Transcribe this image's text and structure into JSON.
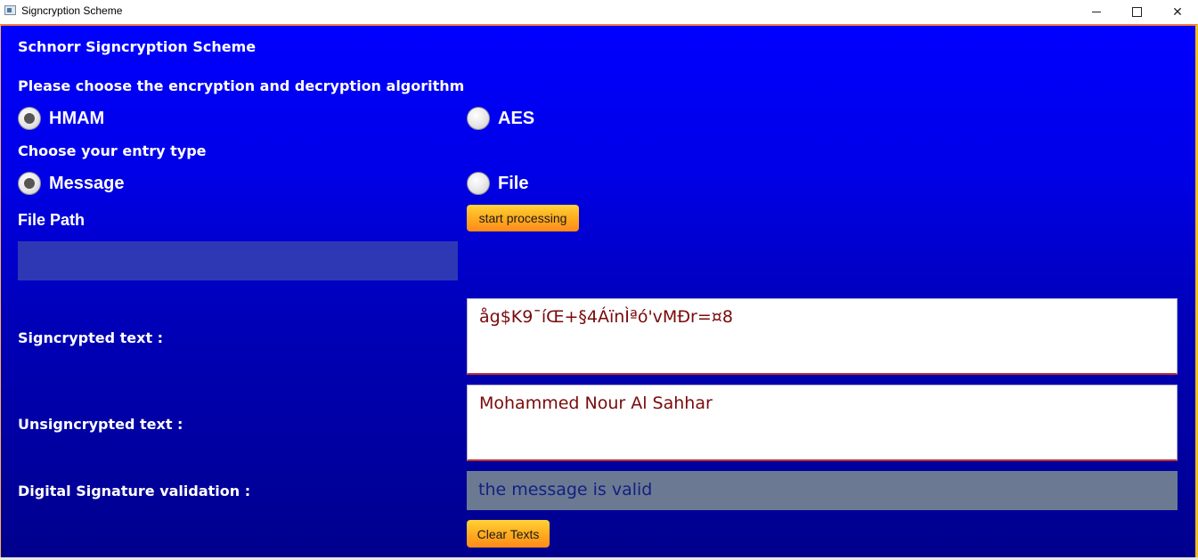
{
  "window": {
    "title": "Signcryption Scheme"
  },
  "app": {
    "heading": "Schnorr Signcryption Scheme",
    "algorithm_prompt": "Please choose the encryption and decryption algorithm",
    "algorithm_options": [
      {
        "label": "HMAM",
        "selected": true
      },
      {
        "label": "AES",
        "selected": false
      }
    ],
    "entry_prompt": "Choose your entry type",
    "entry_options": [
      {
        "label": "Message",
        "selected": true
      },
      {
        "label": "File",
        "selected": false
      }
    ],
    "file_path_label": "File Path",
    "file_path_value": "",
    "start_button": "start processing",
    "signcrypted_label": "Signcrypted text :",
    "signcrypted_value": "åg$K9¯íŒ+§4ÁïnÌªó'vMÐr=¤8",
    "unsigncrypted_label": "Unsigncrypted text :",
    "unsigncrypted_value": "Mohammed Nour Al Sahhar",
    "validation_label": "Digital Signature validation :",
    "validation_value": "the message is valid",
    "clear_button": "Clear Texts"
  },
  "colors": {
    "background_top": "#0000ff",
    "background_bottom": "#00008c",
    "button_orange": "#ffb020",
    "textbox_text": "#7a0a0a"
  }
}
